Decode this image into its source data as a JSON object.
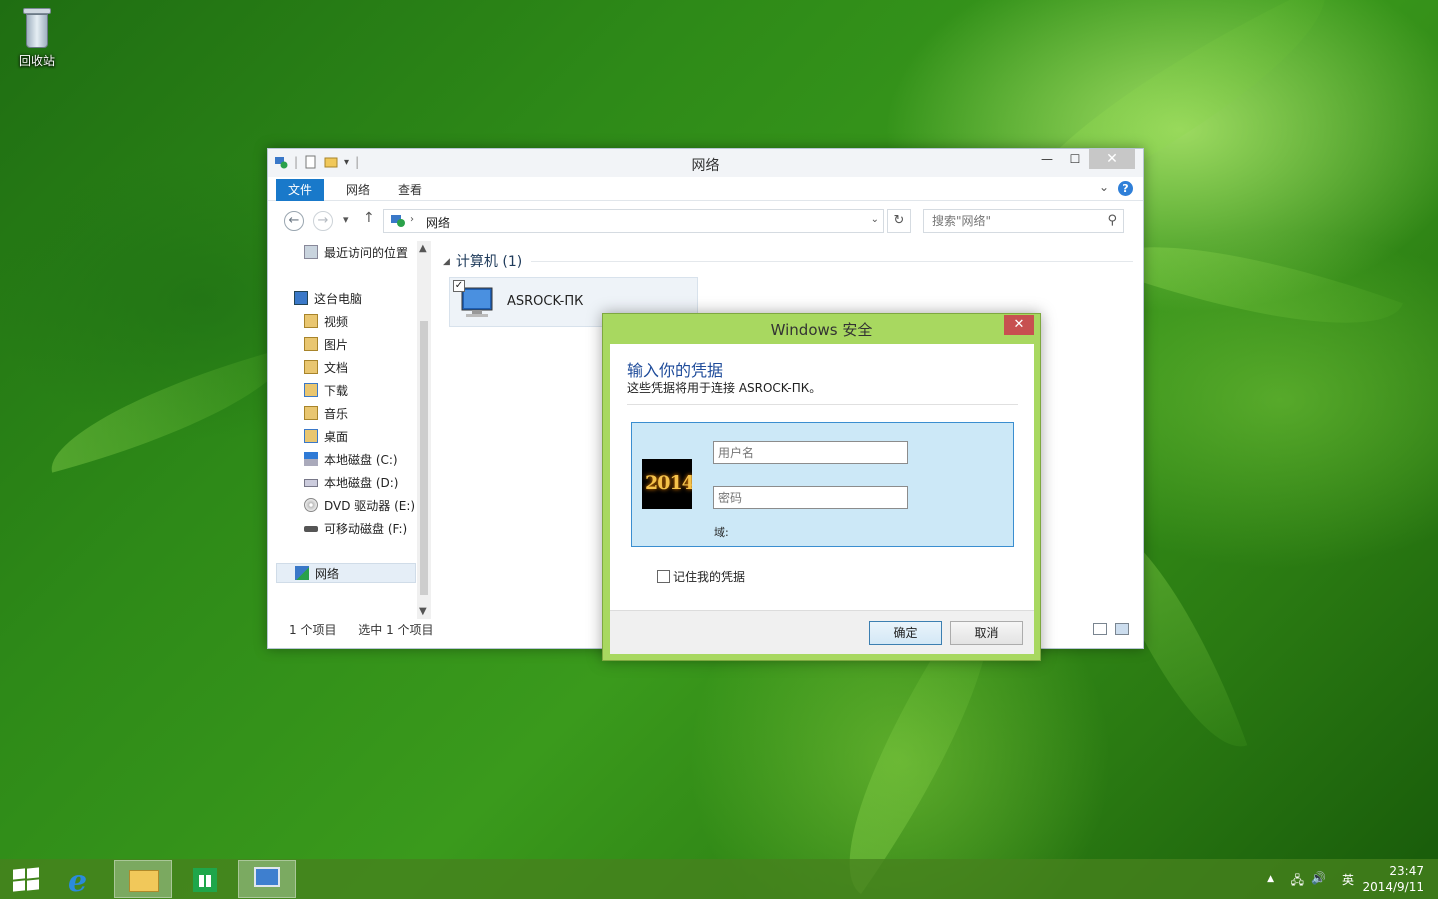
{
  "desktop": {
    "recycle_bin_label": "回收站"
  },
  "explorer": {
    "title": "网络",
    "ribbon_tabs": [
      "文件",
      "网络",
      "查看"
    ],
    "address": "网络",
    "search_placeholder": "搜索\"网络\"",
    "nav": {
      "quick_access": "最近访问的位置",
      "this_pc": "这台电脑",
      "items": [
        "视频",
        "图片",
        "文档",
        "下载",
        "音乐",
        "桌面",
        "本地磁盘 (C:)",
        "本地磁盘 (D:)",
        "DVD 驱动器 (E:)",
        "可移动磁盘 (F:)"
      ],
      "network": "网络"
    },
    "group": {
      "title": "计算机 (1)",
      "computer_name": "ASROCK-ПК"
    },
    "status": {
      "count": "1 个项目",
      "selected": "选中 1 个项目"
    }
  },
  "dialog": {
    "title": "Windows 安全",
    "heading": "输入你的凭据",
    "subtitle": "这些凭据将用于连接 ASROCK-ПК。",
    "avatar_text": "2014",
    "username_placeholder": "用户名",
    "password_placeholder": "密码",
    "domain_label": "域:",
    "remember_label": "记住我的凭据",
    "ok_label": "确定",
    "cancel_label": "取消",
    "close_glyph": "✕"
  },
  "taskbar": {
    "ime": "英",
    "time": "23:47",
    "date": "2014/9/11"
  }
}
